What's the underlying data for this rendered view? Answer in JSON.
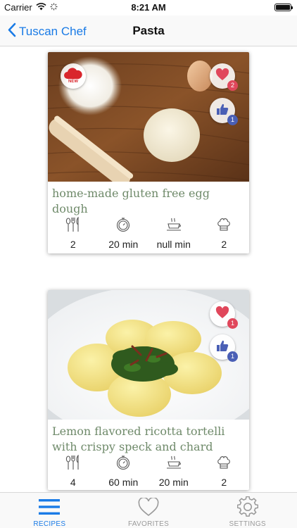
{
  "status_bar": {
    "carrier": "Carrier",
    "time": "8:21 AM"
  },
  "nav": {
    "back_label": "Tuscan Chef",
    "title": "Pasta"
  },
  "recipes": [
    {
      "title": "home-made gluten free egg dough",
      "new_badge": "NEW",
      "favorites_count": "2",
      "likes_count": "1",
      "servings": "2",
      "prep_time": "20 min",
      "cook_time": "null min",
      "difficulty": "2"
    },
    {
      "title": "Lemon flavored ricotta tortelli with crispy speck and chard",
      "favorites_count": "1",
      "likes_count": "1",
      "servings": "4",
      "prep_time": "60 min",
      "cook_time": "20 min",
      "difficulty": "2"
    }
  ],
  "tabs": [
    {
      "label": "RECIPES",
      "icon": "menu-icon",
      "active": true
    },
    {
      "label": "FAVORITES",
      "icon": "heart-icon",
      "active": false
    },
    {
      "label": "SETTINGS",
      "icon": "gear-icon",
      "active": false
    }
  ],
  "colors": {
    "accent": "#1a7be6",
    "title_green": "#6f8a6a",
    "heart_red": "#e0475b",
    "like_blue": "#4a5fb5",
    "inactive": "#9a9a9a"
  }
}
